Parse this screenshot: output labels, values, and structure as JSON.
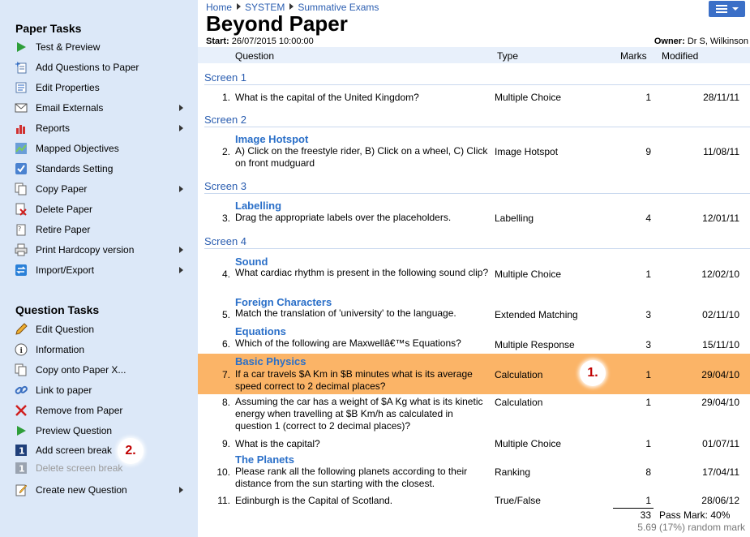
{
  "sidebar": {
    "paper_heading": "Paper Tasks",
    "paper_items": [
      {
        "label": "Test & Preview",
        "icon": "play-icon",
        "submenu": false
      },
      {
        "label": "Add Questions to Paper",
        "icon": "add-question-icon",
        "submenu": false
      },
      {
        "label": "Edit Properties",
        "icon": "properties-icon",
        "submenu": false
      },
      {
        "label": "Email Externals",
        "icon": "email-icon",
        "submenu": true
      },
      {
        "label": "Reports",
        "icon": "bar-chart-icon",
        "submenu": true
      },
      {
        "label": "Mapped Objectives",
        "icon": "objectives-icon",
        "submenu": false
      },
      {
        "label": "Standards Setting",
        "icon": "checkbox-icon",
        "submenu": false
      },
      {
        "label": "Copy Paper",
        "icon": "copy-icon",
        "submenu": true
      },
      {
        "label": "Delete Paper",
        "icon": "delete-doc-icon",
        "submenu": false
      },
      {
        "label": "Retire Paper",
        "icon": "retire-icon",
        "submenu": false
      },
      {
        "label": "Print Hardcopy version",
        "icon": "printer-icon",
        "submenu": true
      },
      {
        "label": "Import/Export",
        "icon": "import-export-icon",
        "submenu": true
      }
    ],
    "question_heading": "Question Tasks",
    "question_items": [
      {
        "label": "Edit Question",
        "icon": "pencil-icon",
        "submenu": false,
        "disabled": false
      },
      {
        "label": "Information",
        "icon": "info-icon",
        "submenu": false,
        "disabled": false
      },
      {
        "label": "Copy onto Paper X...",
        "icon": "copy-icon",
        "submenu": false,
        "disabled": false
      },
      {
        "label": "Link to paper",
        "icon": "link-icon",
        "submenu": false,
        "disabled": false
      },
      {
        "label": "Remove from Paper",
        "icon": "remove-icon",
        "submenu": false,
        "disabled": false
      },
      {
        "label": "Preview Question",
        "icon": "play-icon",
        "submenu": false,
        "disabled": false
      },
      {
        "label": "Add screen break",
        "icon": "screen-break-icon",
        "submenu": false,
        "disabled": false
      },
      {
        "label": "Delete screen break",
        "icon": "screen-break-disabled-icon",
        "submenu": false,
        "disabled": true
      },
      {
        "label": "Create new Question",
        "icon": "new-question-icon",
        "submenu": true,
        "disabled": false
      }
    ],
    "callout_2": "2."
  },
  "breadcrumb": [
    "Home",
    "SYSTEM",
    "Summative Exams"
  ],
  "page_title": "Beyond Paper",
  "start_label": "Start:",
  "start_value": "26/07/2015 10:00:00",
  "owner_label": "Owner:",
  "owner_value": "Dr S, Wilkinson",
  "columns": {
    "question": "Question",
    "type": "Type",
    "marks": "Marks",
    "modified": "Modified"
  },
  "screens": [
    "Screen 1",
    "Screen 2",
    "Screen 3",
    "Screen 4"
  ],
  "questions": [
    {
      "num": "1.",
      "title": "",
      "text": "What is the capital of the United Kingdom?",
      "type": "Multiple Choice",
      "marks": "1",
      "modified": "28/11/11"
    },
    {
      "num": "2.",
      "title": "Image Hotspot",
      "text": "A) Click on the freestyle rider, B) Click on a wheel, C) Click on front mudguard",
      "type": "Image Hotspot",
      "marks": "9",
      "modified": "11/08/11"
    },
    {
      "num": "3.",
      "title": "Labelling",
      "text": "Drag the appropriate labels over the placeholders.",
      "type": "Labelling",
      "marks": "4",
      "modified": "12/01/11"
    },
    {
      "num": "4.",
      "title": "Sound",
      "text": "What cardiac rhythm is present in the following sound clip?",
      "type": "Multiple Choice",
      "marks": "1",
      "modified": "12/02/10"
    },
    {
      "num": "5.",
      "title": "Foreign Characters",
      "text": "Match the translation of 'university' to the language.",
      "type": "Extended Matching",
      "marks": "3",
      "modified": "02/11/10"
    },
    {
      "num": "6.",
      "title": "Equations",
      "text": "Which of the following are Maxwellâ€™s Equations?",
      "type": "Multiple Response",
      "marks": "3",
      "modified": "15/11/10"
    },
    {
      "num": "7.",
      "title": "Basic Physics",
      "text": "If a car travels $A Km in $B minutes what is its average speed correct to 2 decimal places?",
      "type": "Calculation",
      "marks": "1",
      "modified": "29/04/10"
    },
    {
      "num": "8.",
      "title": "",
      "text": "Assuming the car has a weight of $A Kg what is its kinetic energy when travelling at $B Km/h as calculated in question 1 (correct to 2 decimal places)?",
      "type": "Calculation",
      "marks": "1",
      "modified": "29/04/10"
    },
    {
      "num": "9.",
      "title": "",
      "text": "What is the capital?",
      "type": "Multiple Choice",
      "marks": "1",
      "modified": "01/07/11"
    },
    {
      "num": "10.",
      "title": "The Planets",
      "text": "Please rank all the following planets according to their distance from the sun starting with the closest.",
      "type": "Ranking",
      "marks": "8",
      "modified": "17/04/11"
    },
    {
      "num": "11.",
      "title": "",
      "text": "Edinburgh is the Capital of Scotland.",
      "type": "True/False",
      "marks": "1",
      "modified": "28/06/12"
    }
  ],
  "callout_1": "1.",
  "total_marks": "33",
  "pass_mark": "Pass Mark: 40%",
  "random_mark": "5.69 (17%) random mark",
  "colors": {
    "sidebar_bg": "#dce8f8",
    "highlight": "#fbb467",
    "link": "#2a5db0",
    "title_link": "#2a6fc8",
    "menu_button": "#3b6fc7",
    "callout_text": "#c00000"
  }
}
